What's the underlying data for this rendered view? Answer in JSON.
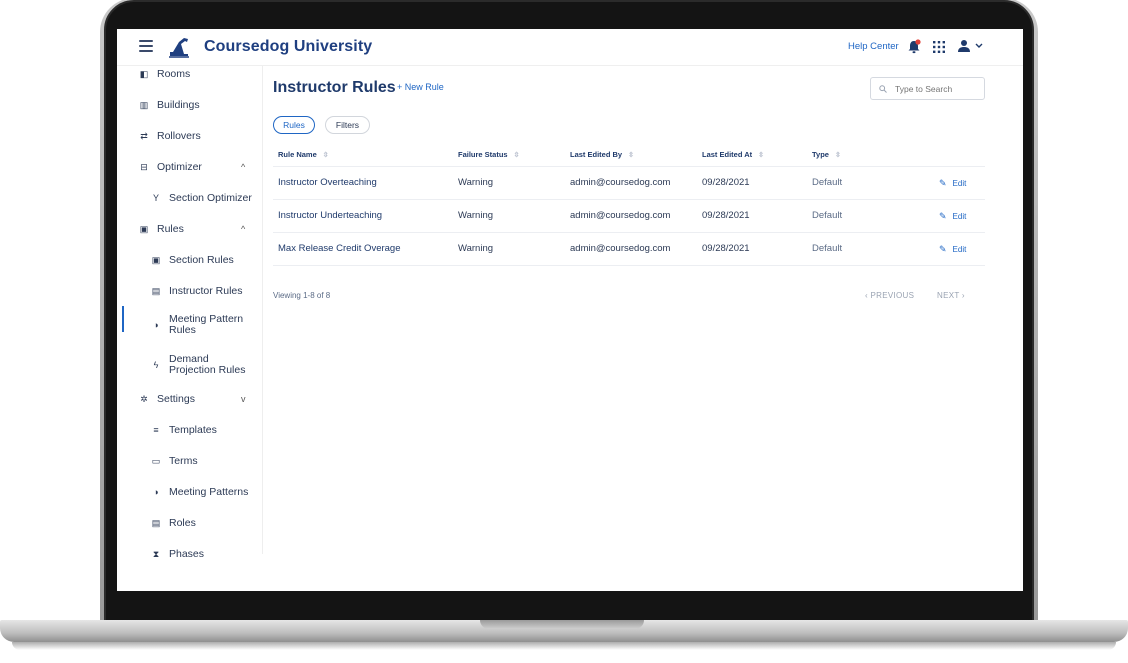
{
  "app": {
    "title": "Coursedog University",
    "help_label": "Help Center"
  },
  "sidebar": {
    "items": [
      {
        "label": "Rooms",
        "icon": "door-icon"
      },
      {
        "label": "Buildings",
        "icon": "building-icon"
      },
      {
        "label": "Rollovers",
        "icon": "swap-icon"
      },
      {
        "label": "Optimizer",
        "icon": "optimizer-icon",
        "chevron": "^"
      },
      {
        "label": "Section Optimizer",
        "icon": "fork-icon"
      },
      {
        "label": "Rules",
        "icon": "clipboard-icon",
        "chevron": "^"
      },
      {
        "label": "Section Rules",
        "icon": "clipboard-icon"
      },
      {
        "label": "Instructor Rules",
        "icon": "id-card-icon"
      },
      {
        "label": "Meeting Pattern",
        "label2": "Rules",
        "icon": "half-circle-icon"
      },
      {
        "label": "Demand",
        "label2": "Projection Rules",
        "icon": "bolt-icon"
      },
      {
        "label": "Settings",
        "icon": "gear-icon",
        "chevron": "v"
      },
      {
        "label": "Templates",
        "icon": "list-icon"
      },
      {
        "label": "Terms",
        "icon": "calendar-icon"
      },
      {
        "label": "Meeting Patterns",
        "icon": "half-circle-icon"
      },
      {
        "label": "Roles",
        "icon": "roles-icon"
      },
      {
        "label": "Phases",
        "icon": "hourglass-icon"
      }
    ]
  },
  "main": {
    "title": "Instructor Rules",
    "new_rule_label": "+ New Rule",
    "search_placeholder": "Type to Search",
    "tabs": [
      {
        "label": "Rules"
      },
      {
        "label": "Filters"
      }
    ],
    "columns": [
      {
        "label": "Rule Name",
        "sort": "⇳"
      },
      {
        "label": "Failure Status",
        "sort": "⇳"
      },
      {
        "label": "Last Edited By",
        "sort": "⇳"
      },
      {
        "label": "Last Edited At",
        "sort": "⇳"
      },
      {
        "label": "Type",
        "sort": "⇳"
      }
    ],
    "rows": [
      {
        "name": "Instructor Overteaching",
        "status": "Warning",
        "edited_by": "admin@coursedog.com",
        "edited_at": "09/28/2021",
        "type": "Default",
        "edit": "Edit"
      },
      {
        "name": "Instructor Underteaching",
        "status": "Warning",
        "edited_by": "admin@coursedog.com",
        "edited_at": "09/28/2021",
        "type": "Default",
        "edit": "Edit"
      },
      {
        "name": "Max Release Credit Overage",
        "status": "Warning",
        "edited_by": "admin@coursedog.com",
        "edited_at": "09/28/2021",
        "type": "Default",
        "edit": "Edit"
      }
    ],
    "viewing_text": "Viewing 1-8 of 8",
    "prev_label": "‹  PREVIOUS",
    "next_label": "NEXT  ›"
  },
  "colors": {
    "brand": "#1f3f80",
    "accent": "#1f66c4",
    "notification": "#e0413a"
  }
}
